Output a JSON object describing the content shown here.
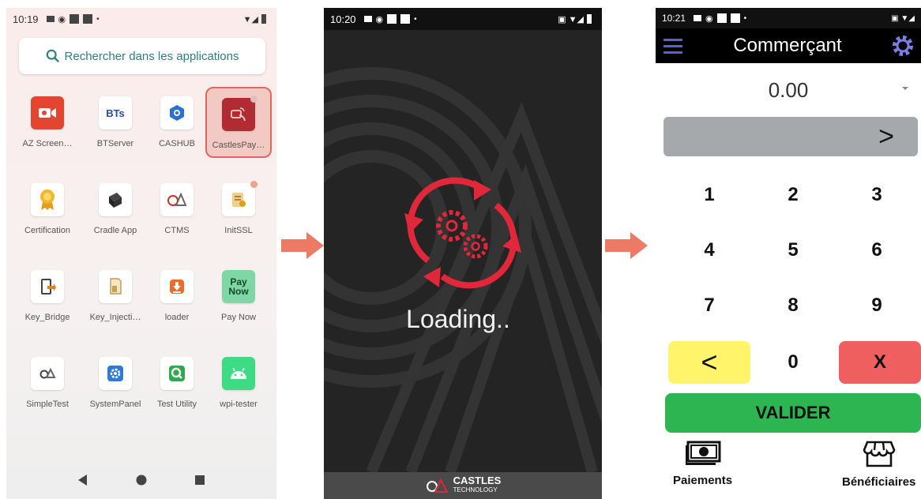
{
  "screen1": {
    "time": "10:19",
    "search_placeholder": "Rechercher dans les applications",
    "apps": [
      {
        "label": "AZ Screen…",
        "icon": "camera-icon"
      },
      {
        "label": "BTServer",
        "icon": "bts-icon",
        "glyph": "BTs"
      },
      {
        "label": "CASHUB",
        "icon": "cashub-icon"
      },
      {
        "label": "CastlesPay…",
        "icon": "castlespay-icon",
        "selected": true
      },
      {
        "label": "Certification",
        "icon": "certificate-icon"
      },
      {
        "label": "Cradle App",
        "icon": "cradle-icon"
      },
      {
        "label": "CTMS",
        "icon": "ctms-icon"
      },
      {
        "label": "InitSSL",
        "icon": "initssl-icon"
      },
      {
        "label": "Key_Bridge",
        "icon": "key-bridge-icon"
      },
      {
        "label": "Key_Injecti…",
        "icon": "key-injection-icon"
      },
      {
        "label": "loader",
        "icon": "loader-icon"
      },
      {
        "label": "Pay Now",
        "icon": "pay-now-icon",
        "glyph": "Pay Now"
      },
      {
        "label": "SimpleTest",
        "icon": "simpletest-icon"
      },
      {
        "label": "SystemPanel",
        "icon": "gear-icon"
      },
      {
        "label": "Test Utility",
        "icon": "test-utility-icon"
      },
      {
        "label": "wpi-tester",
        "icon": "android-icon"
      }
    ]
  },
  "screen2": {
    "time": "10:20",
    "loading_text": "Loading..",
    "brand_name": "CASTLES",
    "brand_sub": "TECHNOLOGY"
  },
  "screen3": {
    "time": "10:21",
    "title": "Commerçant",
    "amount": "0.00",
    "go_label": ">",
    "keys": [
      "1",
      "2",
      "3",
      "4",
      "5",
      "6",
      "7",
      "8",
      "9",
      "<",
      "0",
      "X"
    ],
    "validate_label": "VALIDER",
    "tab_payments": "Paiements",
    "tab_beneficiaries": "Bénéficiaires"
  },
  "colors": {
    "accent_red": "#e0695c",
    "arrow": "#ec7a64",
    "validate_green": "#2db552",
    "clear_red": "#ef5f5f",
    "back_yellow": "#fff46a",
    "loading_ring": "#e0283a"
  }
}
